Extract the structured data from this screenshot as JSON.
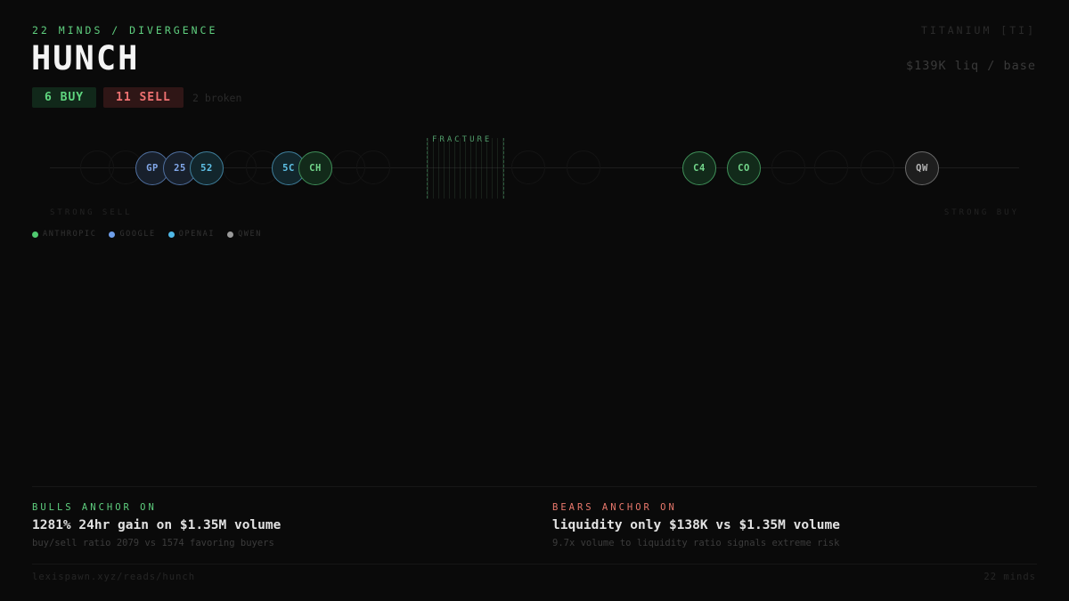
{
  "header": {
    "kicker": "22 MINDS / DIVERGENCE",
    "title": "HUNCH",
    "ticker": "TITANIUM [TI]",
    "liquidity": "$139K liq / base"
  },
  "tally": {
    "buy_label": "6 BUY",
    "sell_label": "11 SELL",
    "broken_label": "2 broken"
  },
  "spectrum": {
    "fracture_label": "FRACTURE",
    "left_label": "STRONG SELL",
    "right_label": "STRONG BUY",
    "minds": [
      {
        "code": "GP",
        "provider": "google"
      },
      {
        "code": "25",
        "provider": "google"
      },
      {
        "code": "52",
        "provider": "openai"
      },
      {
        "code": "5C",
        "provider": "openai"
      },
      {
        "code": "CH",
        "provider": "anthropic"
      },
      {
        "code": "C4",
        "provider": "anthropic"
      },
      {
        "code": "CO",
        "provider": "anthropic"
      },
      {
        "code": "QW",
        "provider": "qwen"
      }
    ]
  },
  "legend": [
    {
      "label": "ANTHROPIC",
      "color": "#4fc96f"
    },
    {
      "label": "GOOGLE",
      "color": "#6f9fea"
    },
    {
      "label": "OPENAI",
      "color": "#4fb8e6"
    },
    {
      "label": "QWEN",
      "color": "#9a9a9a"
    }
  ],
  "bulls": {
    "heading": "BULLS ANCHOR ON",
    "headline": "1281% 24hr gain on $1.35M volume",
    "detail": "buy/sell ratio 2079 vs 1574 favoring buyers"
  },
  "bears": {
    "heading": "BEARS ANCHOR ON",
    "headline": "liquidity only $138K vs $1.35M volume",
    "detail": "9.7x volume to liquidity ratio signals extreme risk"
  },
  "footer": {
    "url": "lexispawn.xyz/reads/hunch",
    "count": "22 minds"
  }
}
